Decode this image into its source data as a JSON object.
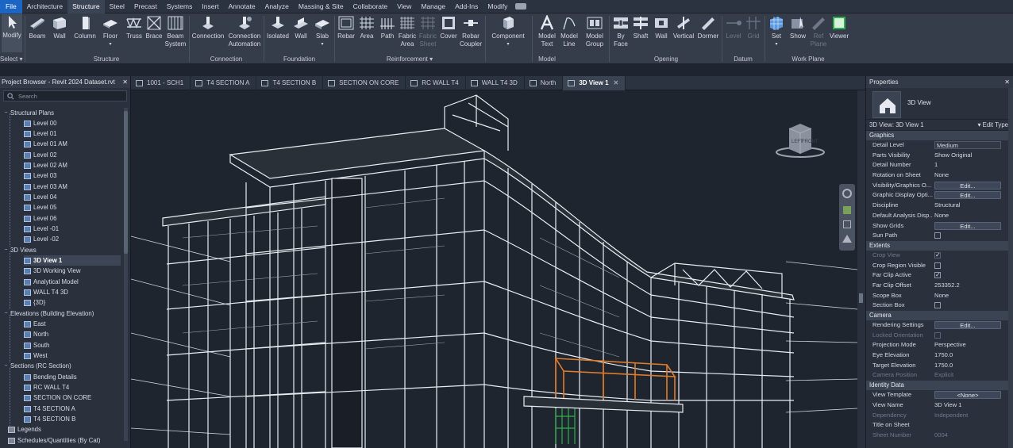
{
  "ribbon_tabs": [
    "File",
    "Architecture",
    "Structure",
    "Steel",
    "Precast",
    "Systems",
    "Insert",
    "Annotate",
    "Analyze",
    "Massing & Site",
    "Collaborate",
    "View",
    "Manage",
    "Add-Ins",
    "Modify"
  ],
  "active_tab": "Structure",
  "tools": {
    "modify": "Modify",
    "select": "Select",
    "beam": "Beam",
    "wall": "Wall",
    "column": "Column",
    "floor": "Floor",
    "truss": "Truss",
    "brace": "Brace",
    "beam_system": "Beam System",
    "connection": "Connection",
    "connection_automation": "Connection Automation",
    "isolated": "Isolated",
    "fwall": "Wall",
    "slab": "Slab",
    "rebar": "Rebar",
    "area": "Area",
    "path": "Path",
    "fabric_area": "Fabric Area",
    "fabric_sheet": "Fabric Sheet",
    "cover": "Cover",
    "rebar_coupler": "Rebar Coupler",
    "component": "Component",
    "model_text": "Model Text",
    "model_line": "Model Line",
    "model_group": "Model Group",
    "by_face": "By Face",
    "shaft": "Shaft",
    "owall": "Wall",
    "vertical": "Vertical",
    "dormer": "Dormer",
    "level": "Level",
    "grid": "Grid",
    "set": "Set",
    "show": "Show",
    "ref_plane": "Ref Plane",
    "viewer": "Viewer"
  },
  "groups": {
    "structure": "Structure",
    "connection": "Connection",
    "foundation": "Foundation",
    "reinforcement": "Reinforcement",
    "model": "Model",
    "opening": "Opening",
    "datum": "Datum",
    "work_plane": "Work Plane"
  },
  "project_browser": {
    "title": "Project Browser - Revit 2024 Dataset.rvt",
    "search_placeholder": "Search",
    "structural_plans": "Structural Plans",
    "plans": [
      "Level 00",
      "Level 01",
      "Level 01 AM",
      "Level 02",
      "Level 02 AM",
      "Level 03",
      "Level 03 AM",
      "Level 04",
      "Level 05",
      "Level 06",
      "Level -01",
      "Level -02"
    ],
    "views_3d": "3D Views",
    "views": [
      "3D View 1",
      "3D Working View",
      "Analytical Model",
      "WALL T4 3D",
      "{3D}"
    ],
    "elevations": "Elevations (Building Elevation)",
    "elev_items": [
      "East",
      "North",
      "South",
      "West"
    ],
    "sections": "Sections (RC Section)",
    "section_items": [
      "Bending Details",
      "RC WALL T4",
      "SECTION ON CORE",
      "T4 SECTION A",
      "T4 SECTION B"
    ],
    "legends": "Legends",
    "schedules": "Schedules/Quantities (By Cat)"
  },
  "view_tabs": [
    "1001 - SCH1",
    "T4 SECTION A",
    "T4 SECTION B",
    "SECTION ON CORE",
    "RC WALL T4",
    "WALL T4 3D",
    "North",
    "3D View 1"
  ],
  "active_view_tab": "3D View 1",
  "viewcube": {
    "left": "LEFT",
    "front": "FRONT"
  },
  "properties": {
    "title": "Properties",
    "type_name": "3D View",
    "instance": "3D View: 3D View 1",
    "edit_type": "Edit Type",
    "sections": {
      "graphics": "Graphics",
      "extents": "Extents",
      "camera": "Camera",
      "identity": "Identity Data"
    },
    "graphics": [
      {
        "k": "Detail Level",
        "v": "Medium"
      },
      {
        "k": "Parts Visibility",
        "v": "Show Original"
      },
      {
        "k": "Detail Number",
        "v": "1"
      },
      {
        "k": "Rotation on Sheet",
        "v": "None"
      },
      {
        "k": "Visibility/Graphics O...",
        "v": "Edit..."
      },
      {
        "k": "Graphic Display Opti...",
        "v": "Edit..."
      },
      {
        "k": "Discipline",
        "v": "Structural"
      },
      {
        "k": "Default Analysis Disp...",
        "v": "None"
      },
      {
        "k": "Show Grids",
        "v": "Edit..."
      },
      {
        "k": "Sun Path",
        "v": ""
      }
    ],
    "extents": [
      {
        "k": "Crop View",
        "v": ""
      },
      {
        "k": "Crop Region Visible",
        "v": ""
      },
      {
        "k": "Far Clip Active",
        "v": ""
      },
      {
        "k": "Far Clip Offset",
        "v": "253352.2"
      },
      {
        "k": "Scope Box",
        "v": "None"
      },
      {
        "k": "Section Box",
        "v": ""
      }
    ],
    "camera": [
      {
        "k": "Rendering Settings",
        "v": "Edit..."
      },
      {
        "k": "Locked Orientation",
        "v": ""
      },
      {
        "k": "Projection Mode",
        "v": "Perspective"
      },
      {
        "k": "Eye Elevation",
        "v": "1750.0"
      },
      {
        "k": "Target Elevation",
        "v": "1750.0"
      },
      {
        "k": "Camera Position",
        "v": "Explicit"
      }
    ],
    "identity": [
      {
        "k": "View Template",
        "v": "<None>"
      },
      {
        "k": "View Name",
        "v": "3D View 1"
      },
      {
        "k": "Dependency",
        "v": "Independent"
      },
      {
        "k": "Title on Sheet",
        "v": ""
      },
      {
        "k": "Sheet Number",
        "v": "0004"
      }
    ]
  },
  "colors": {
    "accent": "#1b66c4",
    "highlight": "#e07b2a",
    "wire": "#e8ecf2",
    "green": "#2fae4a"
  }
}
